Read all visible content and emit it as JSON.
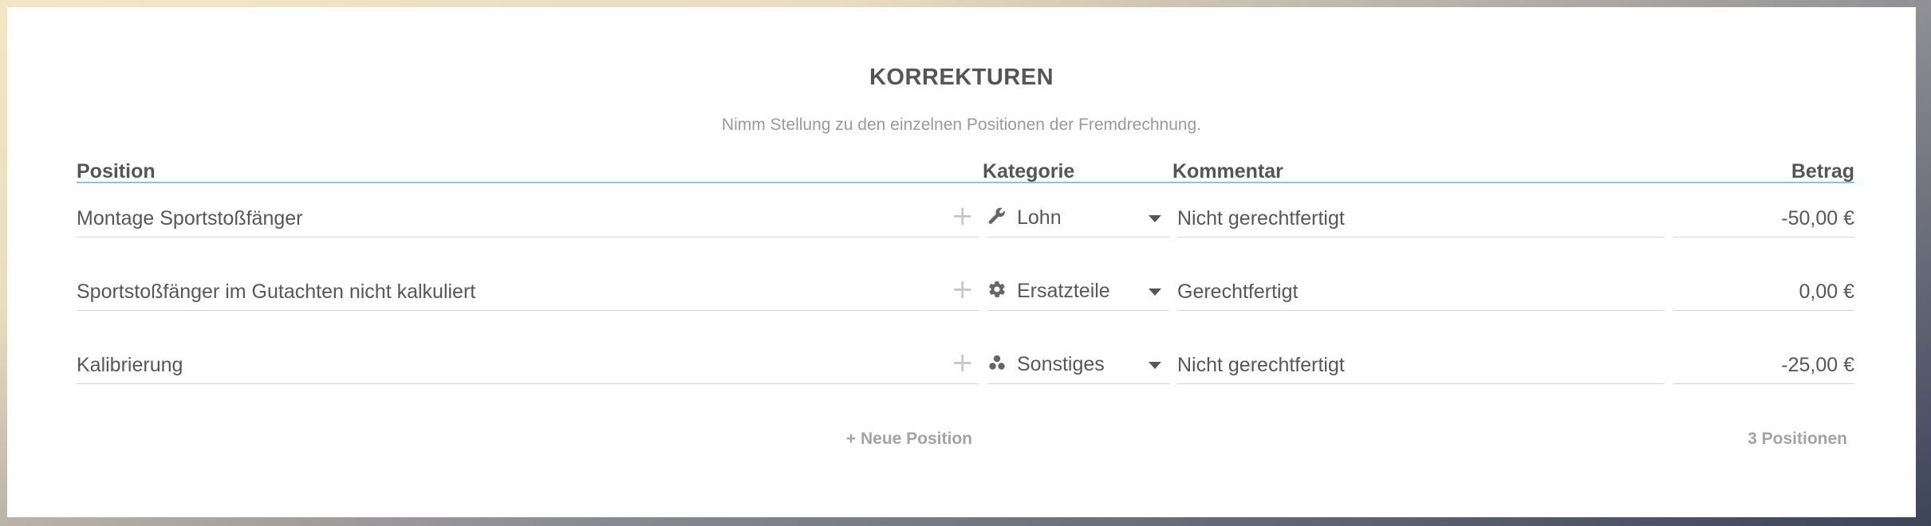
{
  "section": {
    "title": "KORREKTUREN",
    "subtitle": "Nimm Stellung zu den einzelnen Positionen der Fremdrechnung."
  },
  "columns": {
    "position": "Position",
    "category": "Kategorie",
    "comment": "Kommentar",
    "amount": "Betrag"
  },
  "rows": [
    {
      "position": "Montage Sportstoßfänger",
      "category": "Lohn",
      "category_icon": "wrench-icon",
      "comment": "Nicht gerechtfertigt",
      "amount": "-50,00 €"
    },
    {
      "position": "Sportstoßfänger im Gutachten nicht kalkuliert",
      "category": "Ersatzteile",
      "category_icon": "gear-icon",
      "comment": "Gerechtfertigt",
      "amount": "0,00 €"
    },
    {
      "position": "Kalibrierung",
      "category": "Sonstiges",
      "category_icon": "dots-icon",
      "comment": "Nicht gerechtfertigt",
      "amount": "-25,00 €"
    }
  ],
  "footer": {
    "add_label": "+ Neue Position",
    "count_label": "3 Positionen"
  },
  "colors": {
    "accent_line": "#7ec8d8",
    "text": "#575757",
    "muted": "#a3a3a3"
  }
}
